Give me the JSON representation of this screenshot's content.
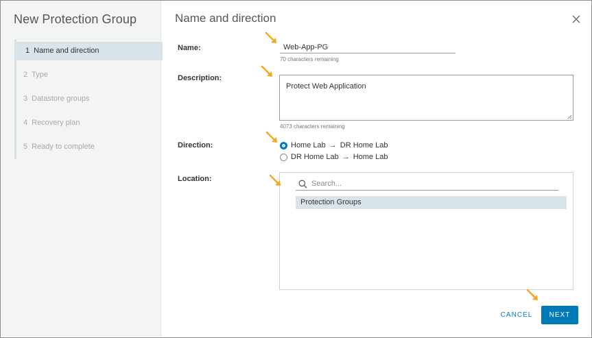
{
  "dialog": {
    "wizard_title": "New Protection Group",
    "page_title": "Name and direction"
  },
  "steps": [
    {
      "num": "1",
      "label": "Name and direction",
      "state": "active"
    },
    {
      "num": "2",
      "label": "Type",
      "state": "disabled"
    },
    {
      "num": "3",
      "label": "Datastore groups",
      "state": "disabled"
    },
    {
      "num": "4",
      "label": "Recovery plan",
      "state": "disabled"
    },
    {
      "num": "5",
      "label": "Ready to complete",
      "state": "disabled"
    }
  ],
  "form": {
    "name_label": "Name:",
    "name_value": "Web-App-PG",
    "name_hint": "70 characters remaining",
    "description_label": "Description:",
    "description_value": "Protect Web Application",
    "description_hint": "4073 characters remaining",
    "direction_label": "Direction:",
    "directions": [
      {
        "from": "Home Lab",
        "arrow": "→",
        "to": "DR Home Lab",
        "selected": true
      },
      {
        "from": "DR Home Lab",
        "arrow": "→",
        "to": "Home Lab",
        "selected": false
      }
    ],
    "location_label": "Location:",
    "search_placeholder": "Search...",
    "location_items": [
      "Protection Groups"
    ]
  },
  "footer": {
    "cancel_label": "CANCEL",
    "next_label": "NEXT"
  },
  "colors": {
    "accent": "#0079b8",
    "annotation_arrow": "#f5a623",
    "selected_bg": "#d9e3ea"
  },
  "icons": {
    "close": "close-icon",
    "search": "search-icon",
    "annotation": "arrow-annotation-icon"
  }
}
